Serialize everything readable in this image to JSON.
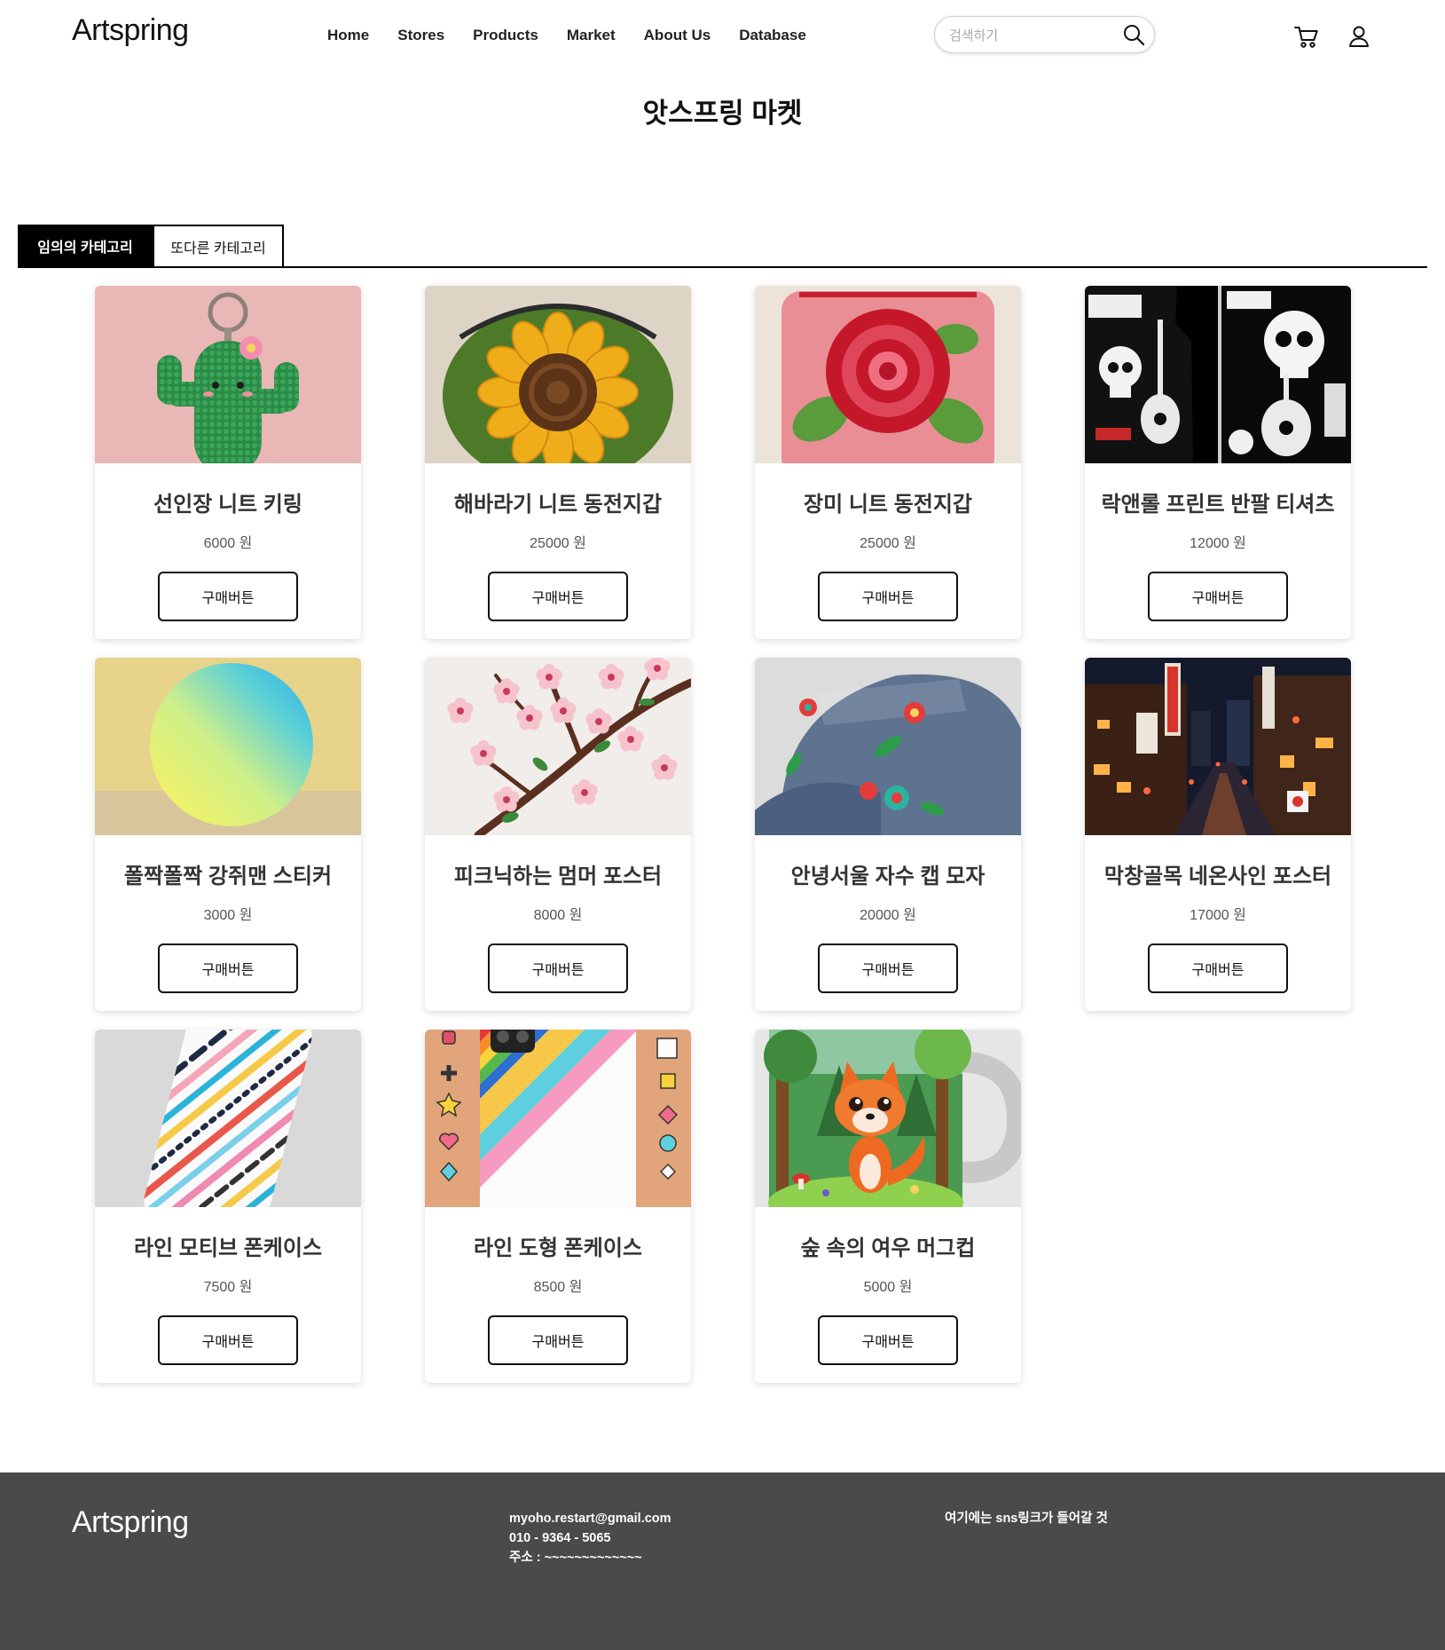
{
  "header": {
    "logo": "Artspring",
    "nav": [
      "Home",
      "Stores",
      "Products",
      "Market",
      "About Us",
      "Database"
    ],
    "search": {
      "placeholder": "검색하기",
      "icon": "search-icon"
    },
    "icons": {
      "cart": "cart-icon",
      "account": "user-icon"
    }
  },
  "page_title": "앗스프링 마켓",
  "tabs": [
    {
      "label": "임의의 카테고리",
      "active": true
    },
    {
      "label": "또다른 카테고리",
      "active": false
    }
  ],
  "market": {
    "buy_button_label": "구매버튼",
    "products": [
      {
        "name": "선인장 니트 키링",
        "price": "6000 원"
      },
      {
        "name": "해바라기 니트 동전지갑",
        "price": "25000 원"
      },
      {
        "name": "장미 니트 동전지갑",
        "price": "25000 원"
      },
      {
        "name": "락앤롤 프린트 반팔 티셔츠",
        "price": "12000 원"
      },
      {
        "name": "폴짝폴짝 강쥐맨 스티커",
        "price": "3000 원"
      },
      {
        "name": "피크닉하는 멈머 포스터",
        "price": "8000 원"
      },
      {
        "name": "안녕서울 자수 캡 모자",
        "price": "20000 원"
      },
      {
        "name": "막창골목 네온사인 포스터",
        "price": "17000 원"
      },
      {
        "name": "라인 모티브 폰케이스",
        "price": "7500 원"
      },
      {
        "name": "라인 도형 폰케이스",
        "price": "8500 원"
      },
      {
        "name": "숲 속의 여우 머그컵",
        "price": "5000 원"
      }
    ]
  },
  "footer": {
    "logo": "Artspring",
    "email": "myoho.restart@gmail.com",
    "phone": "010 - 9364 - 5065",
    "address": "주소 : ~~~~~~~~~~~~~",
    "sns_note": "여기에는 sns링크가 들어갈 것"
  },
  "colors": {
    "text": "#111111",
    "tab_active_bg": "#000000",
    "footer_bg": "#4a4a4a",
    "footer_text": "#ffffff"
  }
}
